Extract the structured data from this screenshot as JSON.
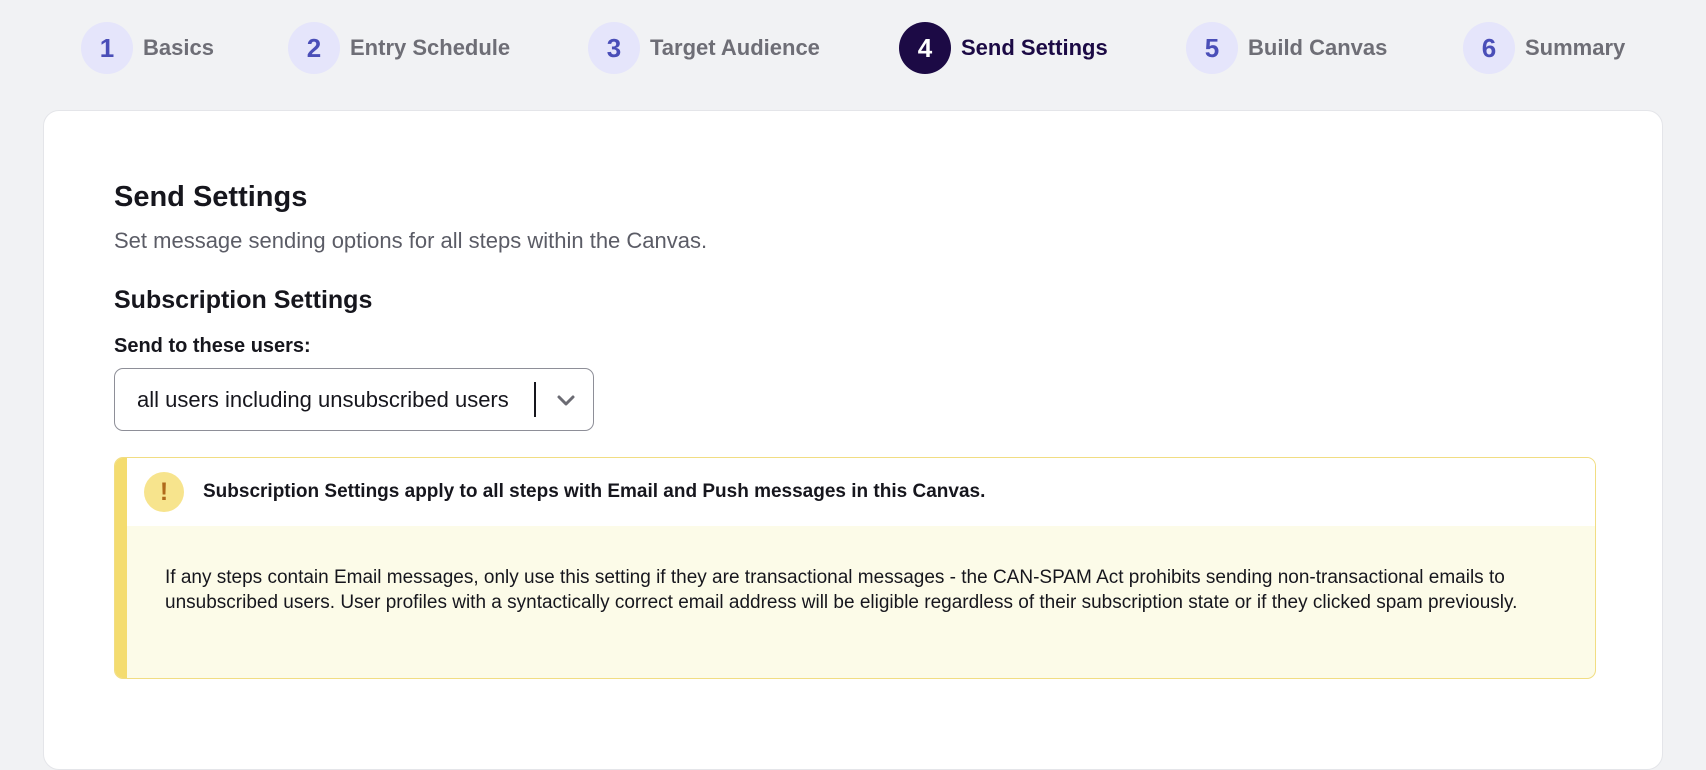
{
  "stepper": {
    "steps": [
      {
        "number": "1",
        "label": "Basics",
        "active": false
      },
      {
        "number": "2",
        "label": "Entry Schedule",
        "active": false
      },
      {
        "number": "3",
        "label": "Target Audience",
        "active": false
      },
      {
        "number": "4",
        "label": "Send Settings",
        "active": true
      },
      {
        "number": "5",
        "label": "Build Canvas",
        "active": false
      },
      {
        "number": "6",
        "label": "Summary",
        "active": false
      }
    ]
  },
  "page": {
    "title": "Send Settings",
    "description": "Set message sending options for all steps within the Canvas."
  },
  "subscription": {
    "section_title": "Subscription Settings",
    "field_label": "Send to these users:",
    "select_value": "all users including unsubscribed users"
  },
  "alert": {
    "icon": "warning-icon",
    "icon_glyph": "!",
    "title": "Subscription Settings apply to all steps with Email and Push messages in this Canvas.",
    "body": "If any steps contain Email messages, only use this setting if they are transactional messages - the CAN-SPAM Act prohibits sending non-transactional emails to unsubscribed users. User profiles with a syntactically correct email address will be eligible regardless of their subscription state or if they clicked spam previously."
  },
  "colors": {
    "background": "#f1f2f4",
    "step_active": "#1c0a45",
    "step_inactive_bg": "#e5e5fb",
    "step_inactive_number": "#4a4eb8",
    "warning_bar": "#f4dc6f",
    "warning_bg": "#fcfbe8"
  }
}
